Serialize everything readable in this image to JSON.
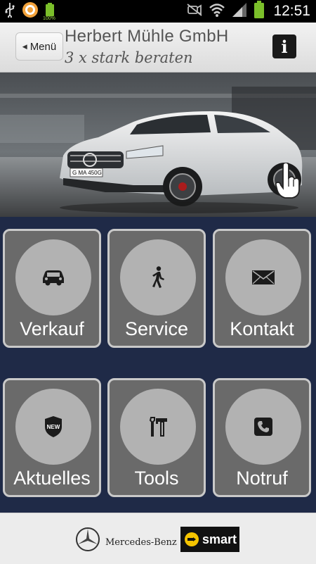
{
  "status_bar": {
    "time": "12:51",
    "battery_small_label": "100%",
    "icons": [
      "usb-icon",
      "app-notification-icon",
      "battery-full-small-icon",
      "mute-icon",
      "wifi-icon",
      "signal-icon",
      "battery-icon"
    ]
  },
  "header": {
    "menu_label": "Menü",
    "company": "Herbert Mühle GmbH",
    "slogan": "3 x stark beraten",
    "info_label": "i"
  },
  "hero": {
    "description_icon": "hand-pointer-icon",
    "plate": "GMA 450"
  },
  "tiles": [
    {
      "label": "Verkauf",
      "icon": "car-icon"
    },
    {
      "label": "Service",
      "icon": "walking-person-icon"
    },
    {
      "label": "Kontakt",
      "icon": "envelope-icon"
    },
    {
      "label": "Aktuelles",
      "icon": "new-badge-icon"
    },
    {
      "label": "Tools",
      "icon": "tools-icon"
    },
    {
      "label": "Notruf",
      "icon": "phone-icon"
    }
  ],
  "footer": {
    "brand1": "Mercedes-Benz",
    "brand2": "smart"
  },
  "colors": {
    "background": "#1f2a47",
    "tile": "#6a6a6a",
    "tile_border": "#c9c9c9",
    "circle": "#b2b2b2",
    "header": "#e6e6e6"
  }
}
